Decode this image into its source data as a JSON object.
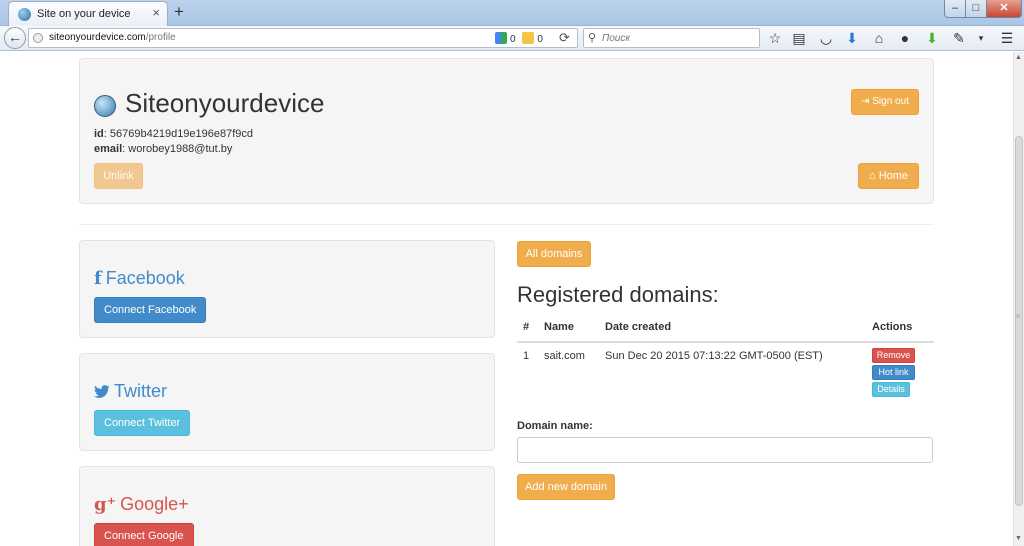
{
  "browser": {
    "tab_title": "Site on your device",
    "tab_close": "×",
    "new_tab": "+",
    "url_host": "siteonyourdevice.com",
    "url_path": "/profile",
    "ext_g_count": "0",
    "ext_y_count": "0",
    "search_placeholder": "Поиск"
  },
  "profile": {
    "site_title": "Siteonyourdevice",
    "id_label": "id",
    "id_value": ": 56769b4219d19e196e87f9cd",
    "email_label": "email",
    "email_value": ": worobey1988@tut.by",
    "signout_label": "Sign out",
    "unlink_label": "Unlink",
    "home_label": "Home"
  },
  "social": {
    "facebook": {
      "title": "Facebook",
      "glyph": "f",
      "button": "Connect Facebook"
    },
    "twitter": {
      "title": "Twitter",
      "button": "Connect Twitter"
    },
    "google": {
      "title": "Google+",
      "glyph": "g⁺",
      "button": "Connect Google"
    }
  },
  "domains": {
    "all_domains_label": "All domains",
    "heading": "Registered domains:",
    "columns": [
      "#",
      "Name",
      "Date created",
      "Actions"
    ],
    "rows": [
      {
        "num": "1",
        "name": "sait.com",
        "date": "Sun Dec 20 2015 07:13:22 GMT-0500 (EST)",
        "actions": [
          "Remove",
          "Hot link",
          "Details"
        ]
      }
    ],
    "domain_name_label": "Domain name:",
    "domain_name_value": "",
    "add_domain_label": "Add new domain"
  },
  "colors": {
    "warning": "#f0ad4e",
    "primary": "#428bca",
    "info": "#5bc0de",
    "danger": "#d9534f"
  }
}
